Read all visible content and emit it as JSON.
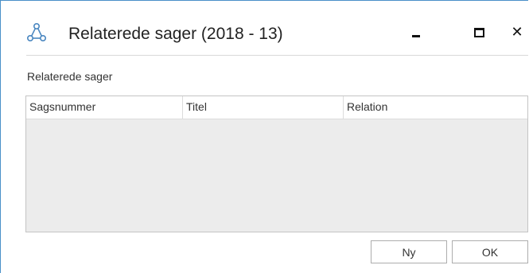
{
  "window": {
    "title": "Relaterede sager (2018 - 13)",
    "icon": "relation-network-icon",
    "controls": {
      "minimize": "minimize-icon",
      "maximize": "maximize-icon",
      "close": "close-icon"
    }
  },
  "section": {
    "label": "Relaterede sager"
  },
  "table": {
    "columns": [
      "Sagsnummer",
      "Titel",
      "Relation"
    ],
    "rows": []
  },
  "buttons": {
    "new_label": "Ny",
    "ok_label": "OK"
  },
  "colors": {
    "accent_border": "#4a90c8",
    "grid_body": "#ececec"
  }
}
